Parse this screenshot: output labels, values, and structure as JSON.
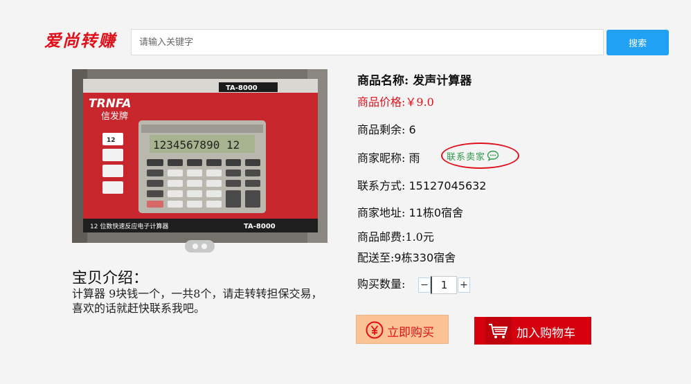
{
  "header": {
    "logo_text": "爱尚转赚",
    "search_placeholder": "请输入关键字",
    "search_button": "搜索"
  },
  "product": {
    "name_label": "商品名称:",
    "name": "发声计算器",
    "price_label": "商品价格:",
    "price": "￥9.0",
    "stock_label": "商品剩余:",
    "stock": "6",
    "seller_label": "商家昵称:",
    "seller": "雨",
    "contact_seller": "联系卖家",
    "phone_label": "联系方式:",
    "phone": "15127045632",
    "address_label": "商家地址:",
    "address": "11栋0宿舍",
    "shipping_label": "商品邮费:",
    "shipping": "1.0元",
    "deliver_label": "配送至:",
    "deliver": "9栋330宿舍",
    "qty_label": "购买数量:",
    "qty": "1",
    "qty_minus": "−",
    "qty_plus": "+"
  },
  "description": {
    "title": "宝贝介绍：",
    "text": "计算器 9块钱一个，一共8个，请走转转担保交易，喜欢的话就赶快联系我吧。"
  },
  "actions": {
    "buy_now": "立即购买",
    "add_to_cart": "加入购物车"
  },
  "image": {
    "box_brand": "TRNFA",
    "box_brand_cn": "信发牌",
    "model": "TA-8000",
    "display": "1234567890 12",
    "box_caption": "12 位数快速反应电子计算器",
    "badge": "12"
  },
  "colors": {
    "accent_red": "#e0101a",
    "search_blue": "#21a1f3",
    "contact_green": "#2e9a4a",
    "buy_now_bg": "#fbc393"
  }
}
